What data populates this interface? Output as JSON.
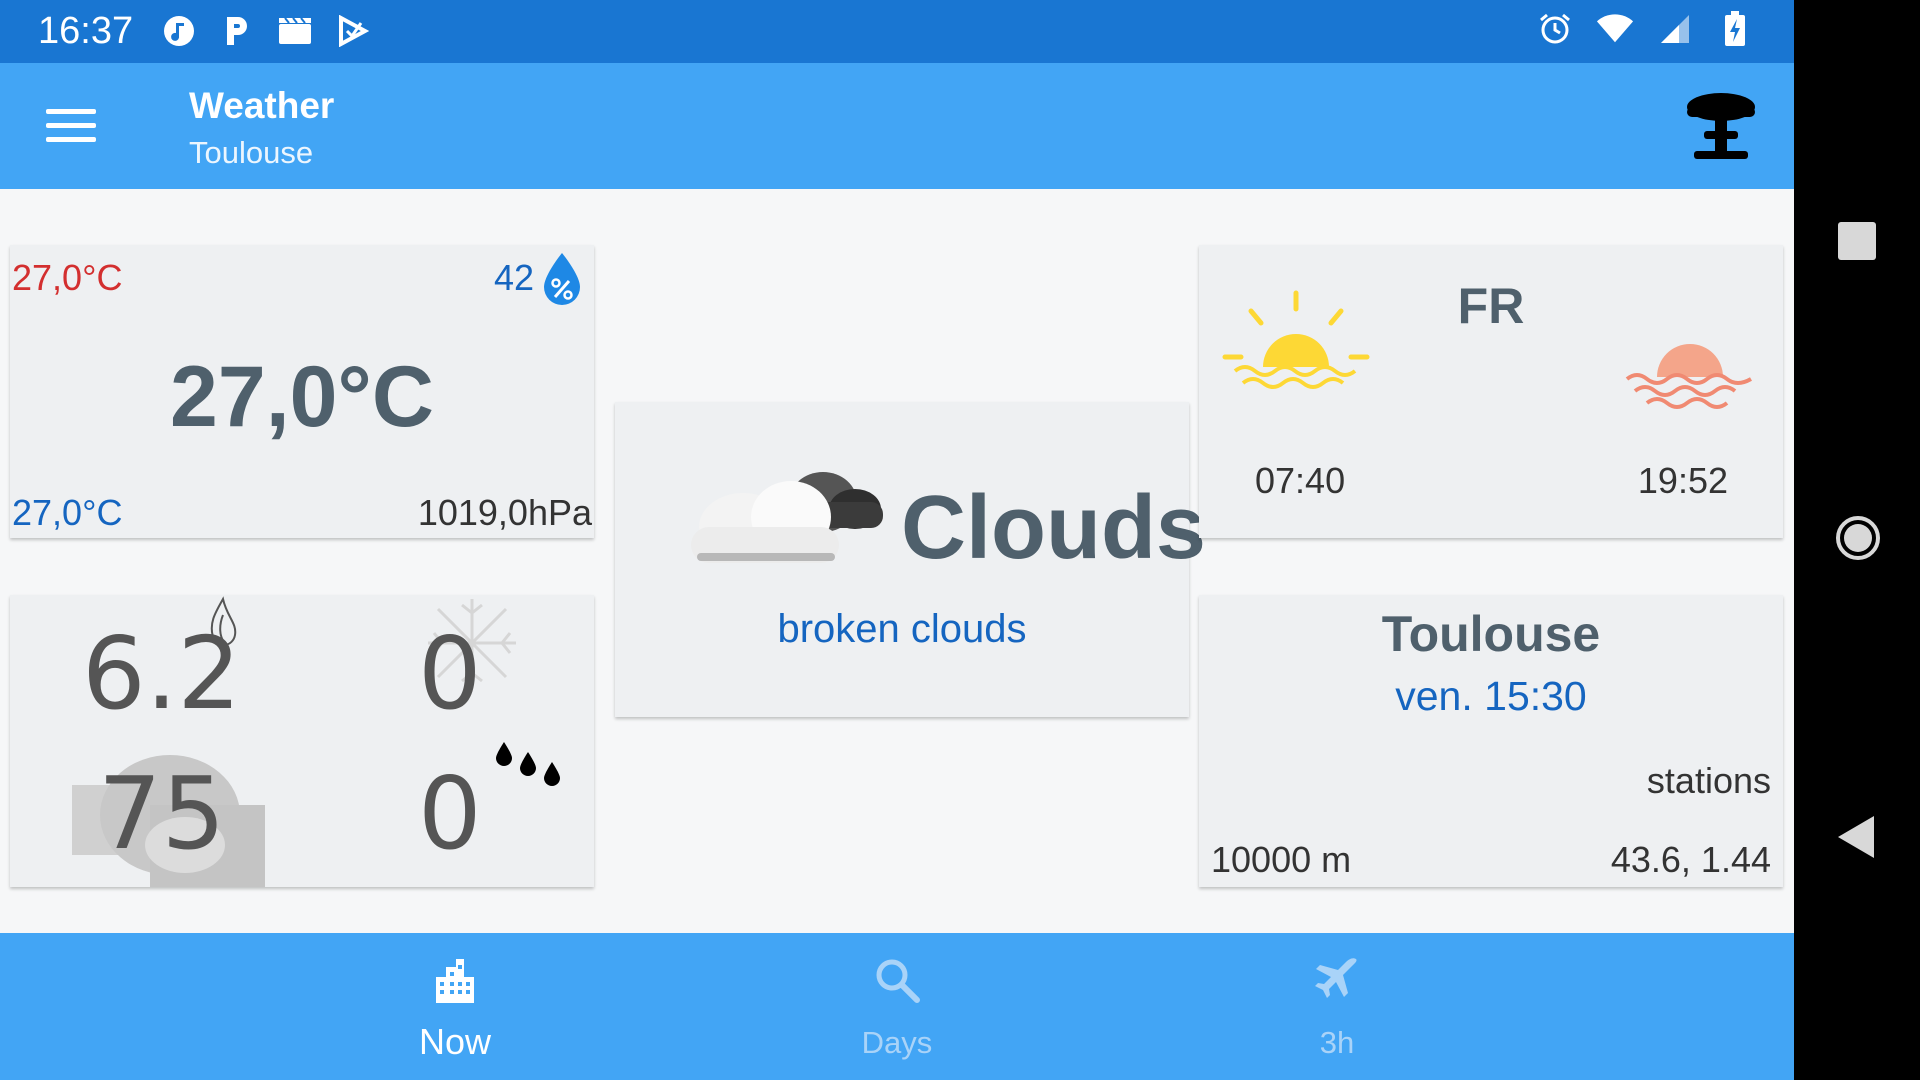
{
  "statusbar": {
    "time": "16:37"
  },
  "appbar": {
    "title": "Weather",
    "subtitle": "Toulouse"
  },
  "temperature": {
    "max": "27,0°C",
    "current": "27,0°C",
    "min": "27,0°C",
    "humidity": "42",
    "pressure": "1019,0hPa"
  },
  "stats": {
    "wind": "6.2",
    "snow": "0",
    "clouds": "75",
    "rain": "0"
  },
  "condition": {
    "main": "Clouds",
    "description": "broken clouds"
  },
  "sun": {
    "country": "FR",
    "sunrise": "07:40",
    "sunset": "19:52"
  },
  "location": {
    "city": "Toulouse",
    "datetime": "ven. 15:30",
    "stations": "stations",
    "visibility": "10000 m",
    "coords": "43.6, 1.44"
  },
  "tabs": [
    {
      "label": "Now",
      "icon": "city-icon"
    },
    {
      "label": "Days",
      "icon": "search-icon"
    },
    {
      "label": "3h",
      "icon": "airplane-icon"
    }
  ],
  "colors": {
    "primary": "#42a5f5",
    "primary_dark": "#1976d2",
    "accent_text": "#1565c0",
    "max_temp": "#d32f2f"
  }
}
